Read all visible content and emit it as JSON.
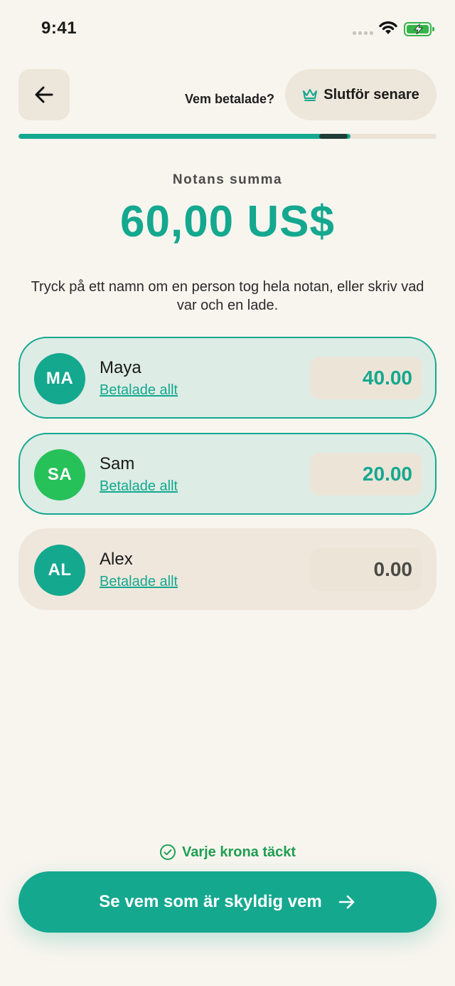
{
  "status_bar": {
    "time": "9:41"
  },
  "header": {
    "step_title": "Vem betalade?",
    "finish_later_label": "Slutför senare",
    "progress_fraction": 0.795
  },
  "bill": {
    "total_label": "Notans summa",
    "total_amount": "60,00 US$",
    "instructions": "Tryck på ett namn om en person tog hela notan, eller skriv vad var och en lade."
  },
  "payers": [
    {
      "initials": "MA",
      "name": "Maya",
      "paid_all_label": "Betalade allt",
      "amount": "40.00",
      "avatar_color": "#14a88f",
      "active": true
    },
    {
      "initials": "SA",
      "name": "Sam",
      "paid_all_label": "Betalade allt",
      "amount": "20.00",
      "avatar_color": "#27c15a",
      "active": true
    },
    {
      "initials": "AL",
      "name": "Alex",
      "paid_all_label": "Betalade allt",
      "amount": "0.00",
      "avatar_color": "#14a88f",
      "active": false
    }
  ],
  "footer": {
    "coverage_status": "Varje krona täckt",
    "primary_button_label": "Se vem som är skyldig vem"
  },
  "colors": {
    "accent": "#14a88f",
    "success": "#1f9e53",
    "background": "#f8f5ef"
  }
}
